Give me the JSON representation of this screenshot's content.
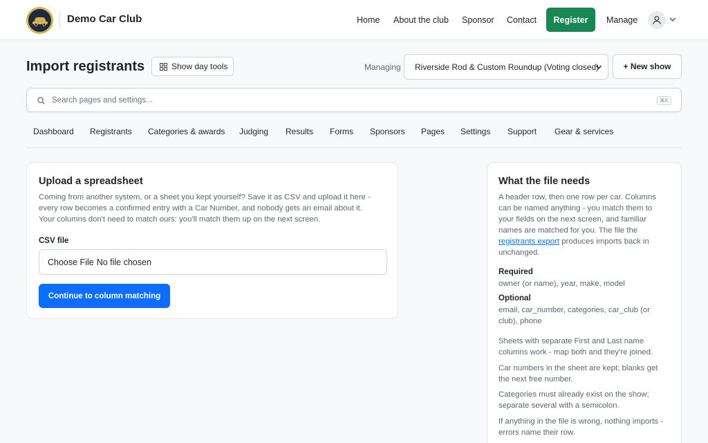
{
  "header": {
    "brand": "Demo Car Club",
    "logo_icon": "car-club-badge",
    "nav": {
      "home": "Home",
      "about": "About the club",
      "sponsor": "Sponsor",
      "contact": "Contact",
      "register": "Register",
      "manage": "Manage"
    },
    "avatar_icon": "person-icon",
    "colors": {
      "register_bg": "#198754"
    }
  },
  "page": {
    "title": "Import registrants",
    "day_tools_label": "Show day tools",
    "managing_label": "Managing",
    "show_selected": "Riverside Rod & Custom Roundup (Voting closed)",
    "new_show_label": "+ New show"
  },
  "search": {
    "placeholder": "Search pages and settings...",
    "shortcut": "⌘K"
  },
  "tabs": [
    "Dashboard",
    "Registrants",
    "Categories & awards",
    "Judging",
    "Results",
    "Forms",
    "Sponsors",
    "Pages",
    "Settings",
    "Support",
    "Gear & services"
  ],
  "upload": {
    "title": "Upload a spreadsheet",
    "description": [
      "Coming from another system, or a sheet you kept yourself? Save it as CSV and upload it here -",
      "every row becomes a confirmed entry with a Car Number, and nobody gets an email about it.",
      "Your columns don't need to match ours: you'll match them up on the next screen."
    ],
    "csv_label": "CSV file",
    "file_button": "Choose File",
    "file_status": "No file chosen",
    "continue_label": "Continue to column matching",
    "colors": {
      "primary": "#0d6efd"
    }
  },
  "needs": {
    "title": "What the file needs",
    "intro_lines": [
      "A header row, then one row per car. Columns",
      "can be named anything - you match them to",
      "your fields on the next screen, and familiar",
      "names are matched for you. The file the"
    ],
    "link_text": "registrants export",
    "after_link": " produces imports back in",
    "last_line": "unchanged.",
    "required_heading": "Required",
    "required_fields": "owner (or name), year, make, model",
    "optional_heading": "Optional",
    "optional_lines": [
      "email, car_number, categories, car_club (or",
      "club), phone"
    ],
    "notes": [
      [
        "Sheets with separate First and Last name",
        "columns work - map both and they're joined."
      ],
      [
        "Car numbers in the sheet are kept; blanks get",
        "the next free number."
      ],
      [
        "Categories must already exist on the show;",
        "separate several with a semicolon."
      ],
      [
        "If anything in the file is wrong, nothing imports -",
        "errors name their row."
      ]
    ]
  }
}
